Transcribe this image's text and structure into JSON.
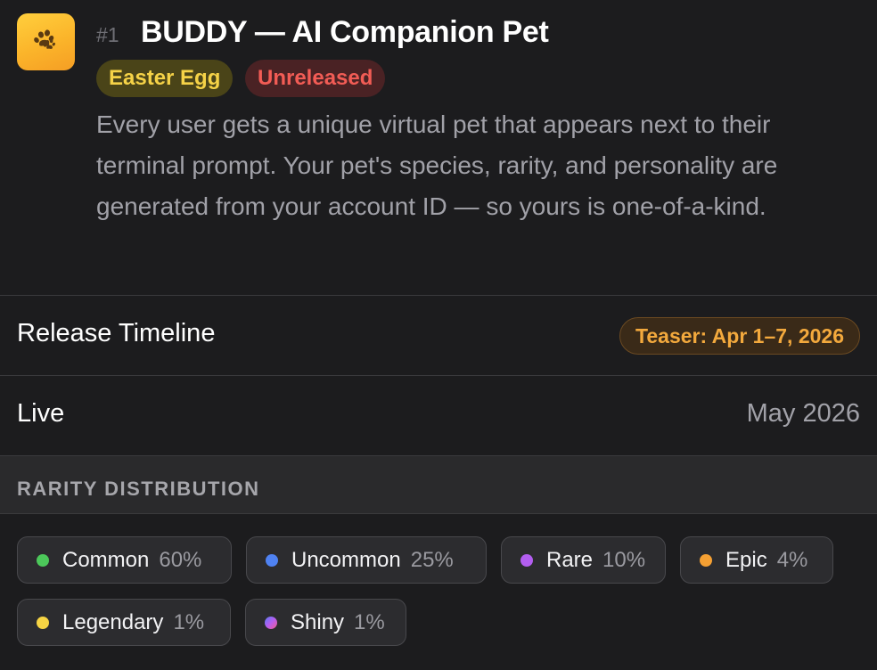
{
  "feature": {
    "icon": "paw-icon",
    "rank": "#1",
    "title": "BUDDY — AI Companion Pet",
    "badges": [
      {
        "label": "Easter Egg",
        "color": "#f5d247",
        "bg": "#4a4418"
      },
      {
        "label": "Unreleased",
        "color": "#f25c55",
        "bg": "#4a2224"
      }
    ],
    "description": "Every user gets a unique virtual pet that appears next to their terminal prompt. Your pet's species, rarity, and personality are generated from your account ID — so yours is one-of-a-kind."
  },
  "timeline": {
    "label": "Release Timeline",
    "value": "Teaser: Apr 1–7, 2026"
  },
  "live": {
    "label": "Live",
    "value": "May 2026"
  },
  "rarity": {
    "title": "RARITY DISTRIBUTION",
    "items": [
      {
        "name": "Common",
        "pct": "60%",
        "color": "#4cc85a"
      },
      {
        "name": "Uncommon",
        "pct": "25%",
        "color": "#4f82f2"
      },
      {
        "name": "Rare",
        "pct": "10%",
        "color": "#b35ef0"
      },
      {
        "name": "Epic",
        "pct": "4%",
        "color": "#f5a033"
      },
      {
        "name": "Legendary",
        "pct": "1%",
        "color": "#f6d444"
      },
      {
        "name": "Shiny",
        "pct": "1%",
        "color": "gradient-purple-pink"
      }
    ]
  },
  "colors": {
    "background": "#1c1c1e",
    "accent_orange": "#f3a93d",
    "muted_text": "#a1a1a8"
  }
}
